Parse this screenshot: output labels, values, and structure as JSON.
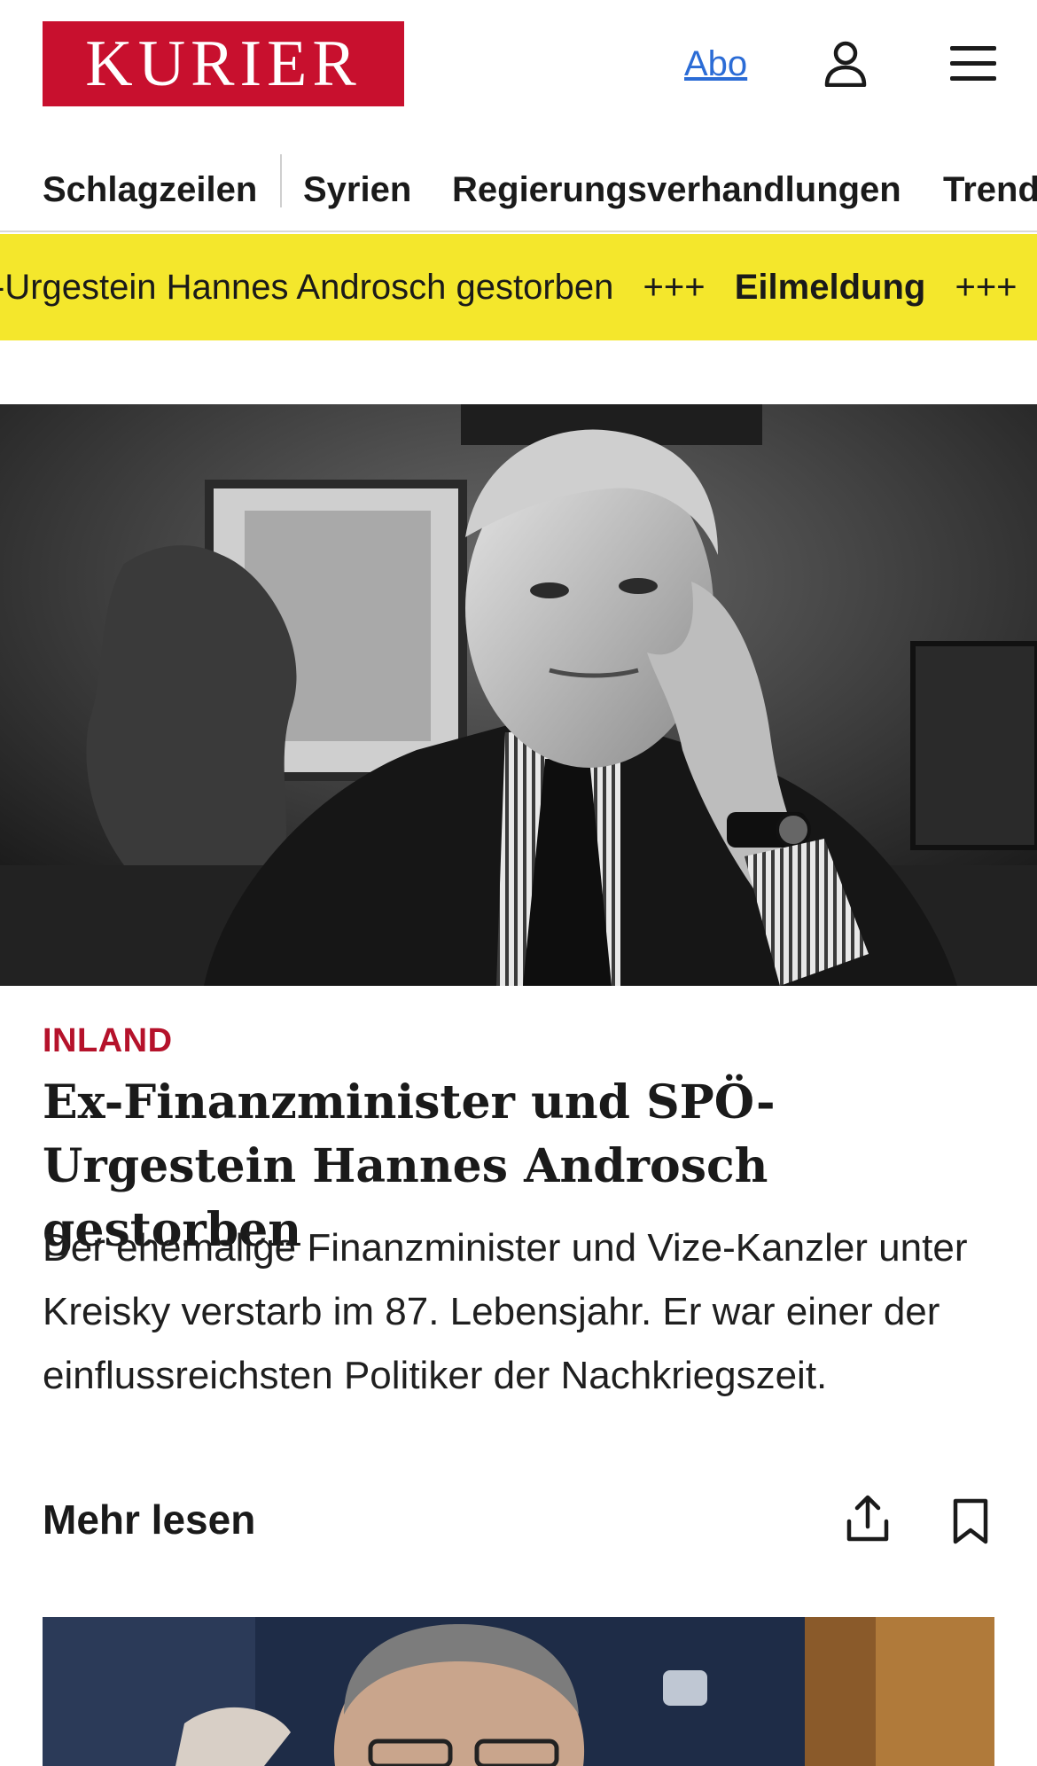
{
  "header": {
    "logo_text": "KURIER",
    "abo_label": "Abo",
    "icons": [
      "user-icon",
      "menu-icon"
    ]
  },
  "nav": {
    "items": [
      {
        "label": "Schlagzeilen"
      },
      {
        "label": "Syrien"
      },
      {
        "label": "Regierungsverhandlungen"
      },
      {
        "label": "Trend"
      }
    ]
  },
  "ticker": {
    "text": "-Urgestein Hannes Androsch gestorben",
    "separator": "+++",
    "label": "Eilmeldung"
  },
  "article": {
    "kicker": "INLAND",
    "headline": "Ex-Finanzminister und SPÖ-Urgestein Hannes Androsch gestorben",
    "lead": "Der ehemalige Finanzminister und Vize-Kanzler unter Kreisky verstarb im 87. Lebensjahr. Er war einer der einflussreichsten Politiker der Nachkriegszeit.",
    "more_label": "Mehr lesen",
    "icons": [
      "share-icon",
      "bookmark-icon"
    ]
  },
  "colors": {
    "brand_red": "#c8102e",
    "kicker_red": "#b5122b",
    "ticker_yellow": "#f4e72c",
    "link_blue": "#2b6cd6"
  }
}
